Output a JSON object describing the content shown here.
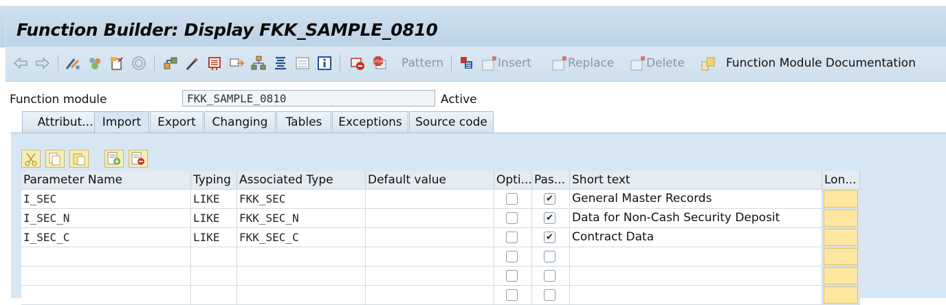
{
  "window": {
    "title": "Function Builder: Display FKK_SAMPLE_0810"
  },
  "toolbar": {
    "pattern_label": "Pattern",
    "insert_label": "Insert",
    "replace_label": "Replace",
    "delete_label": "Delete",
    "docu_label": "Function Module Documentation"
  },
  "form": {
    "fm_label": "Function module",
    "fm_value": "FKK_SAMPLE_0810",
    "status": "Active"
  },
  "tabs": [
    {
      "label": "Attribut..."
    },
    {
      "label": "Import"
    },
    {
      "label": "Export"
    },
    {
      "label": "Changing"
    },
    {
      "label": "Tables"
    },
    {
      "label": "Exceptions"
    },
    {
      "label": "Source code"
    }
  ],
  "active_tab": "Import",
  "table": {
    "columns": [
      "Parameter Name",
      "Typing",
      "Associated Type",
      "Default value",
      "Opti...",
      "Pas...",
      "Short text",
      "Lon..."
    ],
    "rows": [
      {
        "name": "I_SEC",
        "typing": "LIKE",
        "assoc": "FKK_SEC",
        "default": "",
        "optional": false,
        "pass": true,
        "short": "General Master Records"
      },
      {
        "name": "I_SEC_N",
        "typing": "LIKE",
        "assoc": "FKK_SEC_N",
        "default": "",
        "optional": false,
        "pass": true,
        "short": "Data for Non-Cash Security Deposit"
      },
      {
        "name": "I_SEC_C",
        "typing": "LIKE",
        "assoc": "FKK_SEC_C",
        "default": "",
        "optional": false,
        "pass": true,
        "short": "Contract Data"
      },
      {
        "name": "",
        "typing": "",
        "assoc": "",
        "default": "",
        "optional": false,
        "pass": false,
        "short": ""
      },
      {
        "name": "",
        "typing": "",
        "assoc": "",
        "default": "",
        "optional": false,
        "pass": false,
        "short": ""
      },
      {
        "name": "",
        "typing": "",
        "assoc": "",
        "default": "",
        "optional": false,
        "pass": false,
        "short": ""
      }
    ]
  },
  "icons": [
    "back-arrow-icon",
    "forward-arrow-icon",
    "other-object-icon",
    "activate-icon",
    "display-change-icon",
    "where-used-icon",
    "navigate-icon",
    "magic-wand-icon",
    "object-list-icon",
    "navigation-window-icon",
    "hierarchy-icon",
    "pretty-printer-icon",
    "info-panel-icon",
    "info-icon",
    "test-icon",
    "stop-icon",
    "pattern-icon",
    "insert-icon",
    "replace-icon",
    "delete-icon",
    "documentation-icon",
    "cut-icon",
    "copy-icon",
    "paste-icon",
    "insert-row-icon",
    "delete-row-icon"
  ],
  "colors": {
    "title_bg": "#c6d9e9",
    "tab_area_bg": "#d7e6f3",
    "long_text_button": "#fde7a0"
  }
}
